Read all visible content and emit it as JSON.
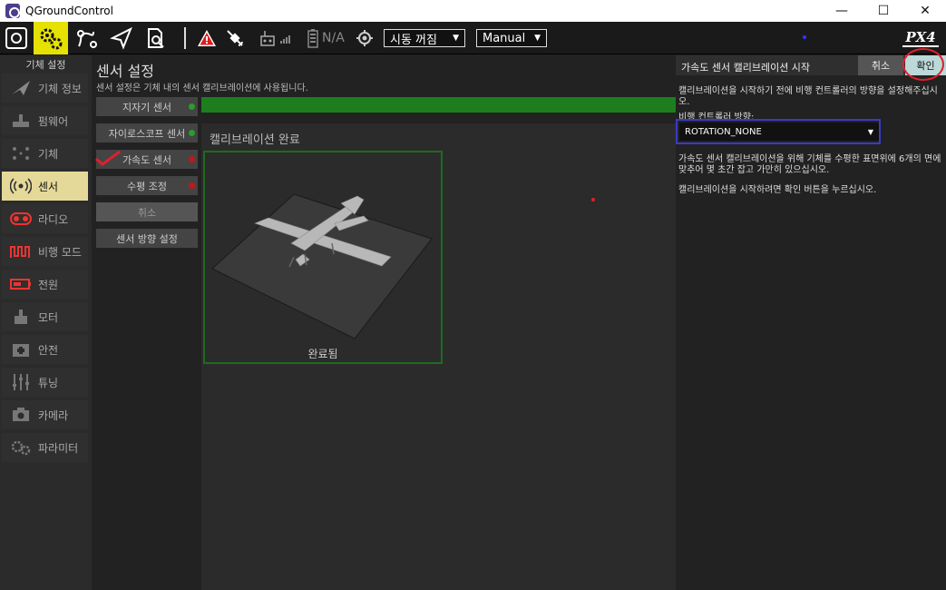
{
  "window": {
    "title": "QGroundControl",
    "min": "—",
    "max": "☐",
    "close": "✕"
  },
  "toolbar": {
    "battery_text": "N/A",
    "arm_status": "시동 꺼짐",
    "flight_mode": "Manual",
    "logo_text": "PX4"
  },
  "leftnav": {
    "header": "기체 설정",
    "items": [
      {
        "label": "기체 정보",
        "icon": "plane-icon"
      },
      {
        "label": "펌웨어",
        "icon": "firmware-icon"
      },
      {
        "label": "기체",
        "icon": "airframe-icon"
      },
      {
        "label": "센서",
        "icon": "sensor-icon"
      },
      {
        "label": "라디오",
        "icon": "radio-icon"
      },
      {
        "label": "비행 모드",
        "icon": "flight-mode-icon"
      },
      {
        "label": "전원",
        "icon": "battery-icon"
      },
      {
        "label": "모터",
        "icon": "motor-icon"
      },
      {
        "label": "안전",
        "icon": "safety-icon"
      },
      {
        "label": "튜닝",
        "icon": "tuning-icon"
      },
      {
        "label": "카메라",
        "icon": "camera-icon"
      },
      {
        "label": "파라미터",
        "icon": "parameter-icon"
      }
    ]
  },
  "main": {
    "title": "센서 설정",
    "subtitle": "센서 설정은 기체 내의 센서 캘리브레이션에 사용됩니다.",
    "sensor_buttons": [
      {
        "label": "지자기 센서",
        "status": "green"
      },
      {
        "label": "자이로스코프 센서",
        "status": "green"
      },
      {
        "label": "가속도 센서",
        "status": "red"
      },
      {
        "label": "수평 조정",
        "status": "red"
      },
      {
        "label": "취소",
        "status": ""
      },
      {
        "label": "센서 방향 설정",
        "status": ""
      }
    ],
    "progress_fraction": 1.0,
    "calibration_heading": "캘리브레이션 완료",
    "done_label": "완료됨"
  },
  "panel": {
    "title": "가속도 센서 캘리브레이션 시작",
    "cancel": "취소",
    "ok": "확인",
    "instruction1": "캘리브레이션을 시작하기 전에 비행 컨트롤러의 방향을 설정해주십시오.",
    "orientation_label": "비행 컨트롤러 방향:",
    "orientation_value": "ROTATION_NONE",
    "instruction2": "가속도 센서 캘리브레이션을 위해 기체를 수평한 표면위에 6개의 면에 맞추어 몇 초간 잡고 가만히 있으십시오.",
    "instruction3": "캘리브레이션을 시작하려면 확인 버튼을 누르십시오."
  },
  "colors": {
    "accent": "#e5d999",
    "progress": "#1e7e1e",
    "highlight": "#3a3ac8",
    "annotation": "#e0202a"
  }
}
